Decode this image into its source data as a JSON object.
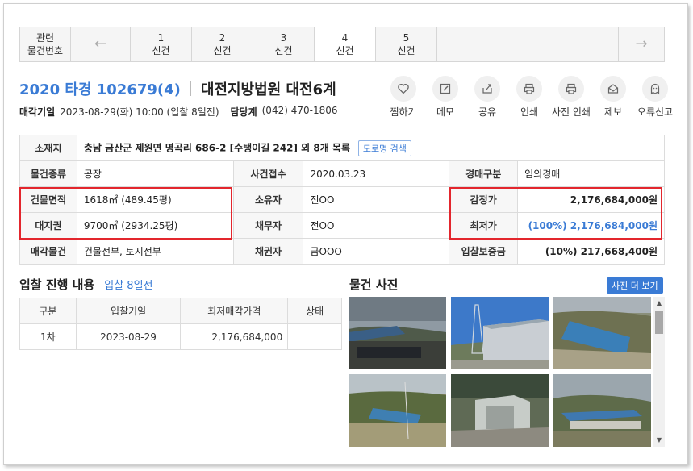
{
  "tabs": {
    "related": [
      "관련",
      "물건번호"
    ],
    "items": [
      {
        "num": "1",
        "label": "신건"
      },
      {
        "num": "2",
        "label": "신건"
      },
      {
        "num": "3",
        "label": "신건"
      },
      {
        "num": "4",
        "label": "신건"
      },
      {
        "num": "5",
        "label": "신건"
      }
    ],
    "active_num": "4"
  },
  "header": {
    "case_no": "2020 타경 102679(4)",
    "court": "대전지방법원 대전6계",
    "sale_date_label": "매각기일",
    "sale_date": "2023-08-29(화) 10:00 (입찰 8일전)",
    "manager_label": "담당계",
    "manager_phone": "(042) 470-1806"
  },
  "actions": [
    {
      "label": "찜하기",
      "icon": "heart-icon"
    },
    {
      "label": "메모",
      "icon": "pencil-icon"
    },
    {
      "label": "공유",
      "icon": "share-icon"
    },
    {
      "label": "인쇄",
      "icon": "printer-icon"
    },
    {
      "label": "사진 인쇄",
      "icon": "photo-print-icon"
    },
    {
      "label": "제보",
      "icon": "envelope-icon"
    },
    {
      "label": "오류신고",
      "icon": "ghost-icon"
    }
  ],
  "info": {
    "location_label": "소재지",
    "location": "충남 금산군 제원면 명곡리 686-2 [수탱이길 242] 외 8개 목록",
    "road_btn": "도로명 검색",
    "type_label": "물건종류",
    "type": "공장",
    "received_label": "사건접수",
    "received": "2020.03.23",
    "auction_kind_label": "경매구분",
    "auction_kind": "임의경매",
    "building_area_label": "건물면적",
    "building_area": "1618㎡ (489.45평)",
    "owner_label": "소유자",
    "owner": "전OO",
    "appraisal_label": "감정가",
    "appraisal": "2,176,684,000원",
    "land_label": "대지권",
    "land": "9700㎡ (2934.25평)",
    "debtor_label": "채무자",
    "debtor": "전OO",
    "min_price_label": "최저가",
    "min_price": "(100%) 2,176,684,000원",
    "sale_object_label": "매각물건",
    "sale_object": "건물전부, 토지전부",
    "creditor_label": "채권자",
    "creditor": "금OOO",
    "deposit_label": "입찰보증금",
    "deposit": "(10%) 217,668,400원"
  },
  "bidding": {
    "title": "입찰 진행 내용",
    "dday": "입찰 8일전",
    "headers": [
      "구분",
      "입찰기일",
      "최저매각가격",
      "상태"
    ],
    "rows": [
      [
        "1차",
        "2023-08-29",
        "2,176,684,000",
        ""
      ]
    ]
  },
  "photos": {
    "title": "물건 사진",
    "more": "사진 더 보기"
  },
  "colors": {
    "accent": "#3a7bd5",
    "highlight": "#e3262d"
  }
}
